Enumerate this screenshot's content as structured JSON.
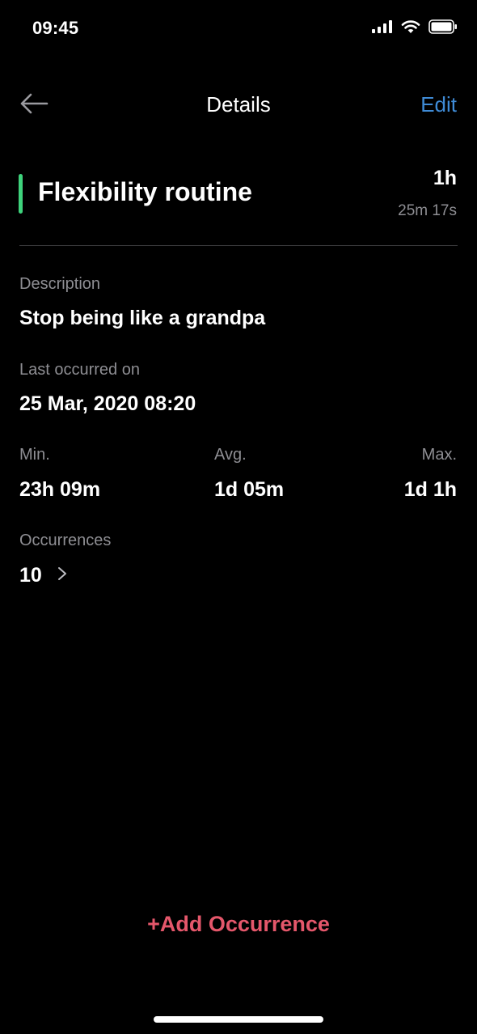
{
  "status_bar": {
    "time": "09:45"
  },
  "nav": {
    "title": "Details",
    "edit_label": "Edit"
  },
  "routine": {
    "title": "Flexibility routine",
    "duration_main": "1h",
    "duration_sub": "25m 17s",
    "accent_color": "#3ed37c"
  },
  "description": {
    "label": "Description",
    "value": "Stop being like a grandpa"
  },
  "last_occurred": {
    "label": "Last occurred on",
    "value": "25 Mar, 2020 08:20"
  },
  "stats": {
    "min_label": "Min.",
    "min_value": "23h 09m",
    "avg_label": "Avg.",
    "avg_value": "1d 05m",
    "max_label": "Max.",
    "max_value": "1d 1h"
  },
  "occurrences": {
    "label": "Occurrences",
    "count": "10"
  },
  "actions": {
    "add_occurrence": "+Add Occurrence"
  },
  "icons": {
    "back": "arrow-left-icon",
    "chevron": "chevron-right-icon",
    "signal": "cellular-signal-icon",
    "wifi": "wifi-icon",
    "battery": "battery-icon"
  },
  "colors": {
    "background": "#000000",
    "accent_blue": "#3f8bd6",
    "accent_red": "#e5576b",
    "accent_green": "#3ed37c",
    "secondary_text": "#8e8e93"
  }
}
